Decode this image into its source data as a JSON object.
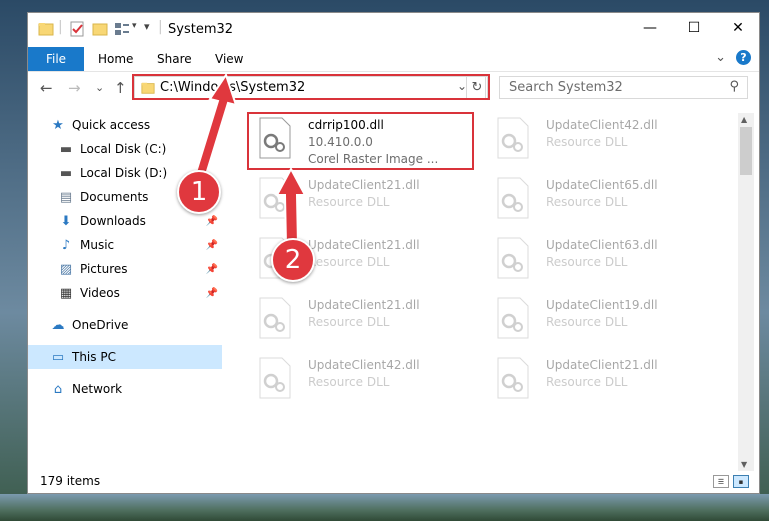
{
  "window": {
    "title": "System32",
    "controls": {
      "minimize": "—",
      "maximize": "☐",
      "close": "✕"
    }
  },
  "ribbon": {
    "file": "File",
    "tabs": [
      "Home",
      "Share",
      "View"
    ],
    "expand": "⌄",
    "help": "?"
  },
  "nav": {
    "back": "←",
    "forward": "→",
    "history": "⌄",
    "up": "↑",
    "address": "C:\\Windows\\System32",
    "address_dropdown": "⌄",
    "refresh": "↻",
    "search_placeholder": "Search System32",
    "search_glyph": "⚲"
  },
  "sidebar": {
    "items": [
      {
        "label": "Quick access",
        "icon": "star-icon",
        "glyph": "★",
        "color": "#2b79c2",
        "pinned": false
      },
      {
        "label": "Local Disk (C:)",
        "icon": "drive-icon",
        "glyph": "▬",
        "color": "#555555",
        "pinned": false
      },
      {
        "label": "Local Disk (D:)",
        "icon": "drive-icon",
        "glyph": "▬",
        "color": "#555555",
        "pinned": false
      },
      {
        "label": "Documents",
        "icon": "documents-icon",
        "glyph": "▤",
        "color": "#6a7c8f",
        "pinned": false
      },
      {
        "label": "Downloads",
        "icon": "downloads-icon",
        "glyph": "⬇",
        "color": "#2b79c2",
        "pinned": true
      },
      {
        "label": "Music",
        "icon": "music-icon",
        "glyph": "♪",
        "color": "#2b79c2",
        "pinned": true
      },
      {
        "label": "Pictures",
        "icon": "pictures-icon",
        "glyph": "▨",
        "color": "#4d7aa7",
        "pinned": true
      },
      {
        "label": "Videos",
        "icon": "videos-icon",
        "glyph": "▦",
        "color": "#333333",
        "pinned": true
      },
      {
        "label": "OneDrive",
        "icon": "onedrive-icon",
        "glyph": "☁",
        "color": "#2b79c2",
        "pinned": false
      },
      {
        "label": "This PC",
        "icon": "this-pc-icon",
        "glyph": "▭",
        "color": "#2b79c2",
        "pinned": false,
        "selected": true
      },
      {
        "label": "Network",
        "icon": "network-icon",
        "glyph": "⌂",
        "color": "#2b79c2",
        "pinned": false
      }
    ],
    "pin_glyph": "📌"
  },
  "files": {
    "highlighted": {
      "name": "cdrrip100.dll",
      "version": "10.410.0.0",
      "description": "Corel Raster Image ..."
    },
    "left_column": [
      {
        "name": "UpdateClient21.dll",
        "type": "Resource DLL"
      },
      {
        "name": "UpdateClient21.dll",
        "type": "Resource DLL"
      },
      {
        "name": "UpdateClient21.dll",
        "type": "Resource DLL"
      },
      {
        "name": "UpdateClient42.dll",
        "type": "Resource DLL"
      }
    ],
    "right_column": [
      {
        "name": "UpdateClient42.dll",
        "type": "Resource DLL"
      },
      {
        "name": "UpdateClient65.dll",
        "type": "Resource DLL"
      },
      {
        "name": "UpdateClient63.dll",
        "type": "Resource DLL"
      },
      {
        "name": "UpdateClient19.dll",
        "type": "Resource DLL"
      },
      {
        "name": "UpdateClient21.dll",
        "type": "Resource DLL"
      }
    ]
  },
  "status": {
    "count": "179 items"
  },
  "annotations": {
    "step1": "1",
    "step2": "2",
    "color": "#e0383e"
  }
}
